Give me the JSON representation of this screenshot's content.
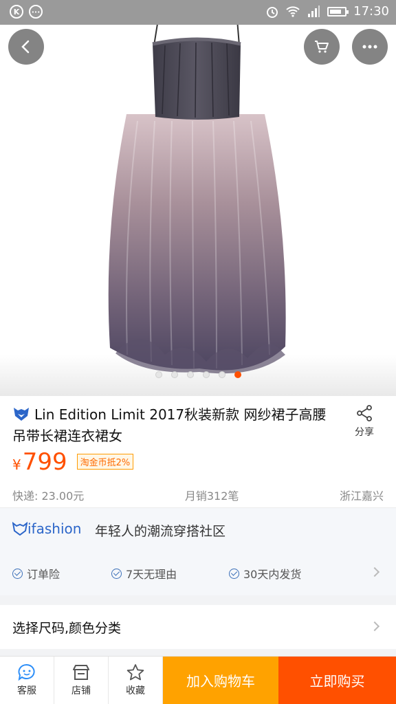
{
  "statusbar": {
    "time": "17:30",
    "left_badge_1": "K",
    "left_badge_2": "···"
  },
  "carousel": {
    "dots": 6,
    "active_index": 5
  },
  "product": {
    "title": "Lin Edition Limit 2017秋装新款 网纱裙子高腰吊带长裙连衣裙女",
    "share_label": "分享",
    "currency": "¥",
    "price": "799",
    "coin_tag": "淘金币抵2%",
    "shipping": "快递: 23.00元",
    "monthly_sales": "月销312笔",
    "location": "浙江嘉兴"
  },
  "ifashion": {
    "logo_text": "ifashion",
    "slogan": "年轻人的潮流穿搭社区"
  },
  "services": [
    "订单险",
    "7天无理由",
    "30天内发货"
  ],
  "select": {
    "label": "选择尺码,颜色分类"
  },
  "bottombar": {
    "service_label": "客服",
    "shop_label": "店铺",
    "favorite_label": "收藏",
    "cart_label": "加入购物车",
    "buy_label": "立即购买"
  },
  "colors": {
    "accent": "#ff5000",
    "cart": "#ffa200",
    "ifashion_blue": "#2c66c9"
  }
}
